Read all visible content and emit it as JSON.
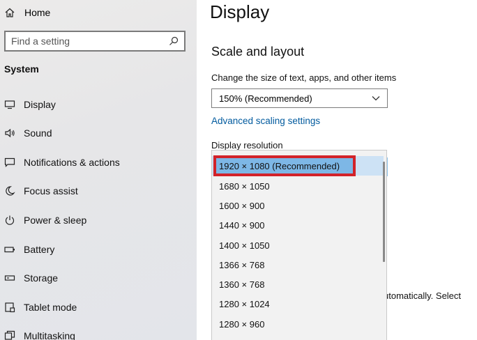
{
  "sidebar": {
    "home_label": "Home",
    "search_placeholder": "Find a setting",
    "section_title": "System",
    "items": [
      {
        "label": "Display",
        "icon": "monitor-icon"
      },
      {
        "label": "Sound",
        "icon": "speaker-icon"
      },
      {
        "label": "Notifications & actions",
        "icon": "notification-icon"
      },
      {
        "label": "Focus assist",
        "icon": "moon-icon"
      },
      {
        "label": "Power & sleep",
        "icon": "power-icon"
      },
      {
        "label": "Battery",
        "icon": "battery-icon"
      },
      {
        "label": "Storage",
        "icon": "storage-icon"
      },
      {
        "label": "Tablet mode",
        "icon": "tablet-icon"
      },
      {
        "label": "Multitasking",
        "icon": "multitasking-icon"
      }
    ]
  },
  "main": {
    "title": "Display",
    "scale_section_title": "Scale and layout",
    "scale_label": "Change the size of text, apps, and other items",
    "scale_value": "150% (Recommended)",
    "advanced_link": "Advanced scaling settings",
    "resolution_label": "Display resolution",
    "trailing_text": "utomatically. Select",
    "resolution_options": [
      "1920 × 1080 (Recommended)",
      "1680 × 1050",
      "1600 × 900",
      "1440 × 900",
      "1400 × 1050",
      "1366 × 768",
      "1360 × 768",
      "1280 × 1024",
      "1280 × 960"
    ],
    "selected_index": 0
  },
  "colors": {
    "link": "#005a9e",
    "highlight": "#d2232a",
    "selection": "#7db7e6"
  }
}
